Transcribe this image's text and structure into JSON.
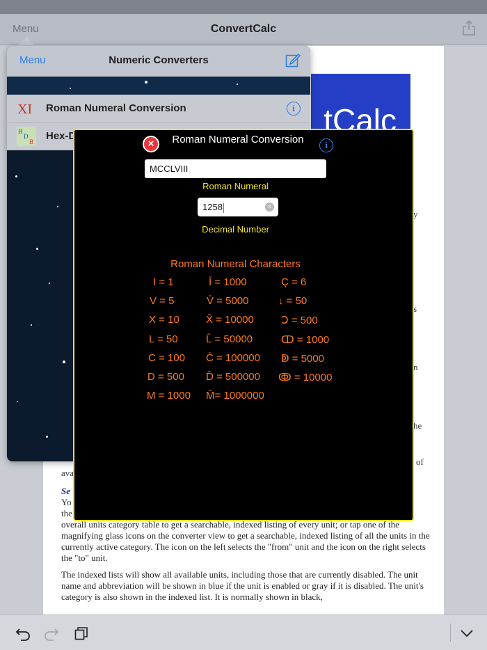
{
  "topbar": {
    "menu_label": "Menu",
    "title": "ConvertCalc",
    "share_icon": "share-icon"
  },
  "document": {
    "logo_text": "tCalc",
    "fragments": [
      "y",
      "s",
      "n",
      "he",
      "of",
      "ava",
      "Se",
      "Yo",
      "the"
    ],
    "paragraph1": "overall units category table to get a searchable, indexed listing of every unit; or tap one of the magnifying glass icons on the converter view to get a searchable, indexed listing of all the units in the currently active category. The icon on the left selects the \"from\" unit and the icon on the right selects the \"to\" unit.",
    "paragraph2": "The indexed lists will show all available units, including those that are currently disabled. The unit name and abbreviation will be shown in blue if the unit is enabled or gray if it is disabled. The unit's category is also shown in the indexed list. It is normally shown in black,"
  },
  "popover": {
    "back_label": "Menu",
    "title": "Numeric Converters",
    "edit_icon": "compose-icon",
    "rows": [
      {
        "icon_text": "XI",
        "label": "Roman Numeral Conversion"
      },
      {
        "icon_text": "HDB",
        "label": "Hex-D"
      }
    ],
    "info_glyph": "i"
  },
  "modal": {
    "title": "Roman Numeral Conversion",
    "close_glyph": "×",
    "info_glyph": "i",
    "roman_value": "MCCLVIII",
    "roman_label": "Roman Numeral",
    "decimal_value": "1258",
    "decimal_label": "Decimal Number",
    "clear_glyph": "×",
    "chars_title": "Roman Numeral Characters",
    "chars": [
      [
        "I = 1",
        "Ī = 1000",
        "Ç = 6"
      ],
      [
        "V = 5",
        "V̄ = 5000",
        "↓ = 50"
      ],
      [
        "X = 10",
        "X̄ = 10000",
        "Ↄ = 500"
      ],
      [
        "L = 50",
        "L̄ = 50000",
        "ↀ = 1000"
      ],
      [
        "C = 100",
        "C̄ = 100000",
        "ↁ = 5000"
      ],
      [
        "D = 500",
        "D̄ = 500000",
        "ↂ = 10000"
      ],
      [
        "M = 1000",
        "M̄= 1000000",
        ""
      ]
    ],
    "accent_color": "#ff7a1a",
    "label_color": "#f2e51a"
  },
  "bottombar": {
    "undo_icon": "undo-icon",
    "redo_icon": "redo-icon",
    "pages_icon": "pages-icon",
    "collapse_icon": "chevron-down-icon"
  }
}
